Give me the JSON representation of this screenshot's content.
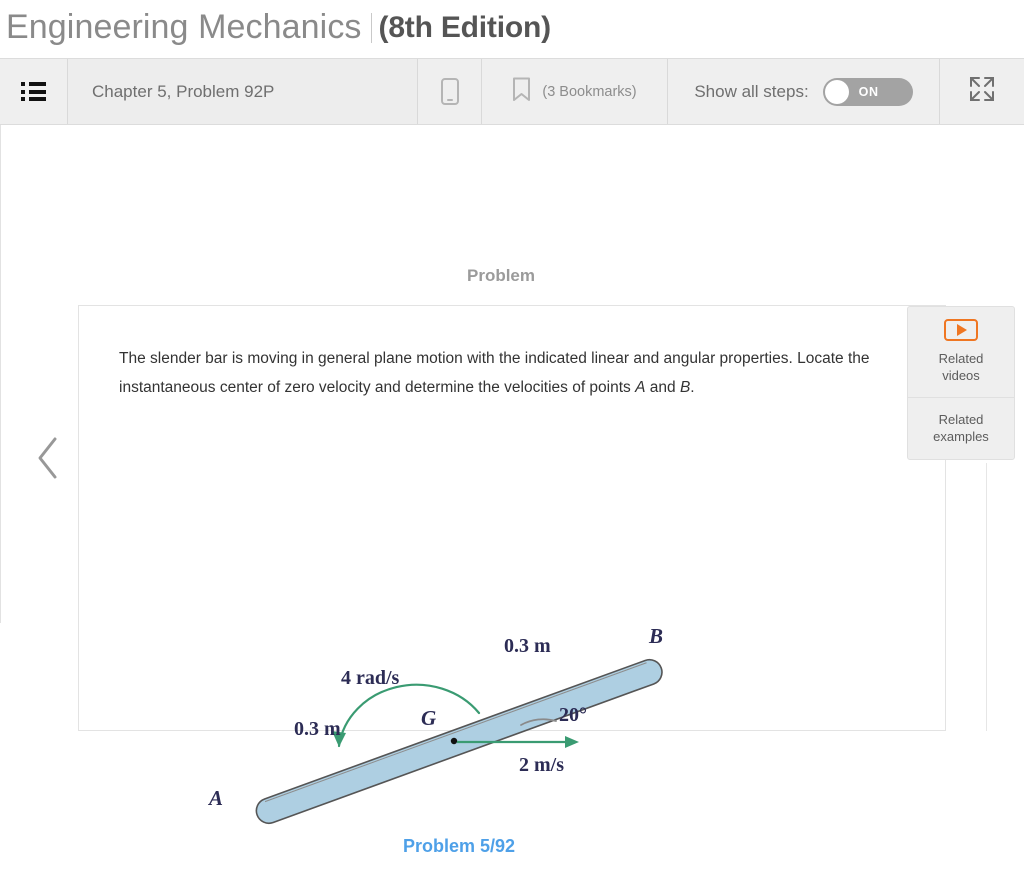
{
  "book": {
    "title": "Engineering Mechanics",
    "separator": "|",
    "edition": "(8th Edition)"
  },
  "toolbar": {
    "menu_icon": "list-icon",
    "problem_label": "Chapter 5, Problem 92P",
    "mobile_icon": "mobile-device-icon",
    "bookmark_icon": "bookmark-icon",
    "bookmarks_label": "(3 Bookmarks)",
    "steps_label": "Show all steps:",
    "toggle_state": "ON",
    "toggle_color": "#a3a3a3",
    "fullscreen_icon": "fullscreen-expand-icon"
  },
  "navigation": {
    "prev_icon": "chevron-left-icon"
  },
  "main": {
    "heading": "Problem",
    "problem_text_part1": "The slender bar is moving in general plane motion with the indicated linear and angular properties. Locate the instantaneous center of zero velocity and determine the velocities of points ",
    "problem_text_italic_a": "A",
    "problem_text_mid": " and ",
    "problem_text_italic_b": "B",
    "problem_text_end": "."
  },
  "related_panel": {
    "play_icon": "play-button-icon",
    "videos_line1": "Related",
    "videos_line2": "videos",
    "examples_line1": "Related",
    "examples_line2": "examples",
    "accent_color": "#ef7622"
  },
  "figure": {
    "caption": "Problem 5/92",
    "caption_color": "#4ea0e8",
    "bar_fill": "#aecfe2",
    "bar_stroke": "#4a4a4a",
    "arrow_color": "#3a9b72",
    "label_color": "#2c2c55",
    "label_a": "A",
    "label_b": "B",
    "label_g": "G",
    "length_left": "0.3 m",
    "length_right": "0.3 m",
    "angular_velocity": "4 rad/s",
    "linear_velocity": "2 m/s",
    "angle": "20°"
  }
}
